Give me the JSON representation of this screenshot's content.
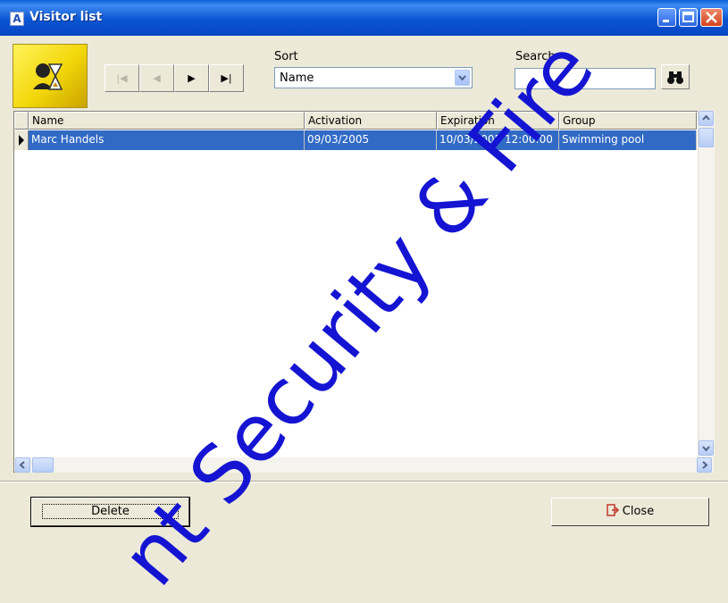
{
  "window": {
    "title": "Visitor list"
  },
  "toolbar": {
    "nav": [
      {
        "name": "first-record-button",
        "glyph": "|◀",
        "enabled": false
      },
      {
        "name": "previous-record-button",
        "glyph": "◀",
        "enabled": false
      },
      {
        "name": "next-record-button",
        "glyph": "▶",
        "enabled": true
      },
      {
        "name": "last-record-button",
        "glyph": "▶|",
        "enabled": true
      }
    ],
    "sort_label": "Sort",
    "sort_value": "Name",
    "search_label": "Search",
    "search_value": ""
  },
  "grid": {
    "columns": [
      "Name",
      "Activation",
      "Expiration",
      "Group"
    ],
    "rows": [
      [
        "Marc Handels",
        "09/03/2005",
        "10/03/2005 12:00:00",
        "Swimming pool"
      ]
    ],
    "selected_row_color": "#316ac5"
  },
  "buttons": {
    "delete": "Delete",
    "close": "Close"
  },
  "watermark": "nt Security & Fire"
}
